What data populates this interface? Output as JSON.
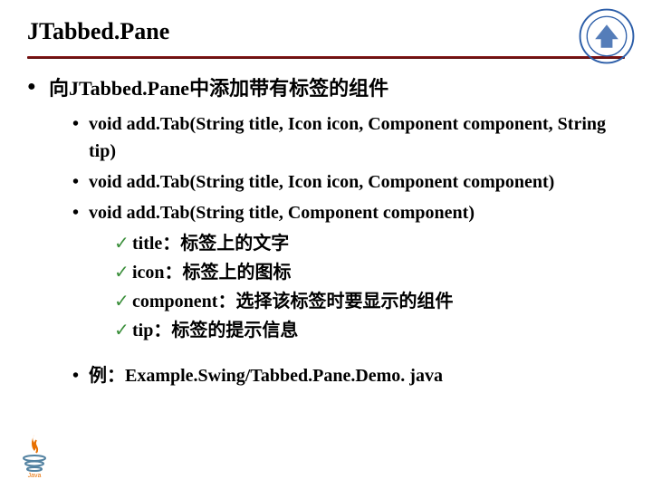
{
  "title": "JTabbed.Pane",
  "heading": "向JTabbed.Pane中添加带有标签的组件",
  "methods": {
    "m1": "void add.Tab(String title, Icon icon, Component component, String tip)",
    "m2": "void add.Tab(String title, Icon icon, Component component)",
    "m3": "void add.Tab(String title, Component component)"
  },
  "params": {
    "p1": "title：标签上的文字",
    "p2": "icon：标签上的图标",
    "p3": "component：选择该标签时要显示的组件",
    "p4": "tip：标签的提示信息"
  },
  "example": "例：Example.Swing/Tabbed.Pane.Demo. java"
}
